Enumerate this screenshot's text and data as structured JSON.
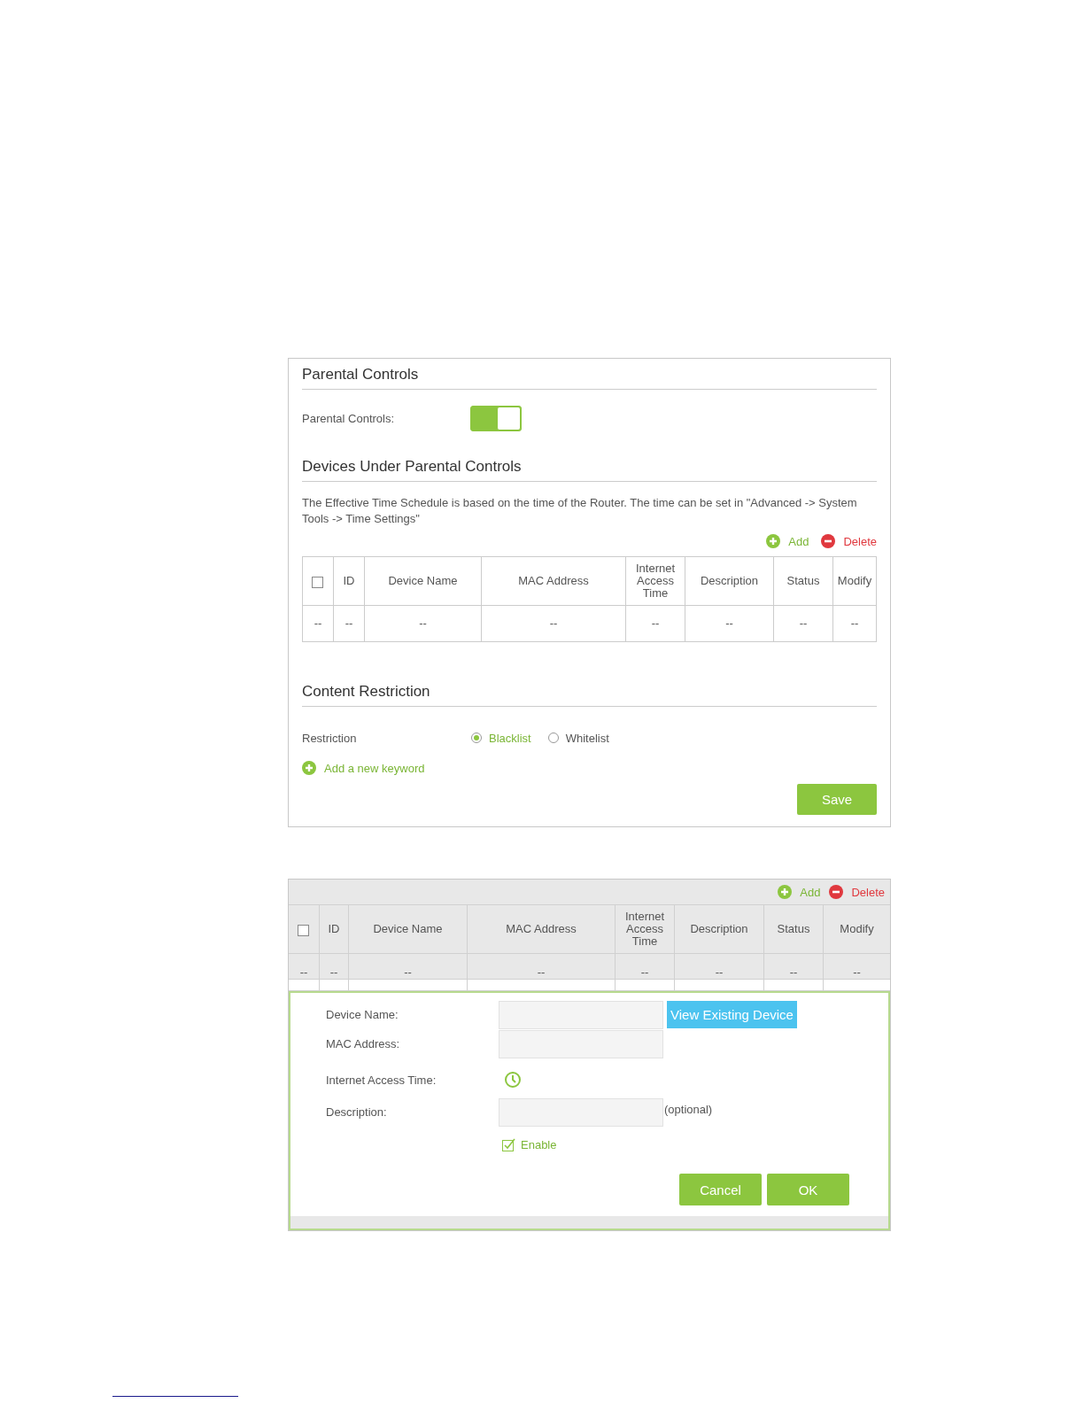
{
  "parental_controls_panel": {
    "title": "Parental Controls",
    "toggle": {
      "label": "Parental Controls:",
      "on": true
    },
    "devices_section": {
      "title": "Devices Under Parental Controls",
      "note": "The Effective Time Schedule is based on the time of the Router. The time can be set in \"Advanced -> System Tools -> Time Settings\"",
      "actions": [
        {
          "kind": "add",
          "label": "Add"
        },
        {
          "kind": "delete",
          "label": "Delete"
        }
      ],
      "table": {
        "columns": [
          {
            "kind": "checkbox",
            "checked": false
          },
          {
            "kind": "text",
            "label": "ID"
          },
          {
            "kind": "text",
            "label": "Device Name"
          },
          {
            "kind": "text",
            "label": "MAC Address"
          },
          {
            "kind": "text",
            "label": "Internet Access Time"
          },
          {
            "kind": "text",
            "label": "Description"
          },
          {
            "kind": "text",
            "label": "Status"
          },
          {
            "kind": "text",
            "label": "Modify"
          }
        ],
        "rows": [
          [
            "--",
            "--",
            "--",
            "--",
            "--",
            "--",
            "--",
            "--"
          ]
        ]
      }
    },
    "content_section": {
      "title": "Content Restriction",
      "restriction_label": "Restriction",
      "options": [
        {
          "label": "Blacklist",
          "selected": true
        },
        {
          "label": "Whitelist",
          "selected": false
        }
      ],
      "add_keyword": "Add a new keyword"
    },
    "save_button": "Save"
  },
  "add_device_panel": {
    "actions": [
      {
        "kind": "add",
        "label": "Add"
      },
      {
        "kind": "delete",
        "label": "Delete"
      }
    ],
    "table": {
      "columns": [
        {
          "kind": "checkbox",
          "checked": false
        },
        {
          "kind": "text",
          "label": "ID"
        },
        {
          "kind": "text",
          "label": "Device Name"
        },
        {
          "kind": "text",
          "label": "MAC Address"
        },
        {
          "kind": "text",
          "label": "Internet Access Time"
        },
        {
          "kind": "text",
          "label": "Description"
        },
        {
          "kind": "text",
          "label": "Status"
        },
        {
          "kind": "text",
          "label": "Modify"
        }
      ],
      "rows": [
        [
          "--",
          "--",
          "--",
          "--",
          "--",
          "--",
          "--",
          "--"
        ]
      ]
    },
    "form": {
      "fields": [
        {
          "kind": "input",
          "label": "Device Name:",
          "button": "View Existing Device"
        },
        {
          "kind": "input",
          "label": "MAC Address:"
        },
        {
          "kind": "clock",
          "label": "Internet Access Time:"
        },
        {
          "kind": "input",
          "label": "Description:",
          "hint": "(optional)"
        }
      ],
      "enable": {
        "label": "Enable",
        "checked": true
      },
      "buttons": [
        "Cancel",
        "OK"
      ]
    }
  }
}
